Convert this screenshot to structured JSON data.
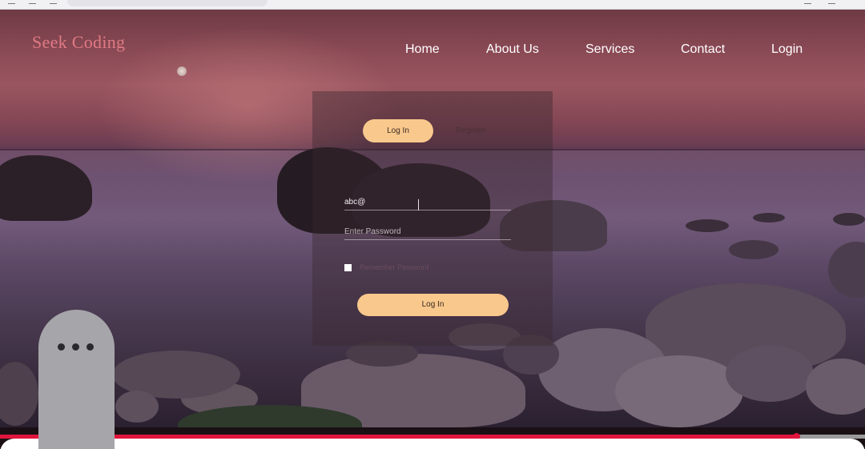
{
  "brand": {
    "name": "Seek Coding"
  },
  "nav": {
    "items": [
      {
        "label": "Home"
      },
      {
        "label": "About Us"
      },
      {
        "label": "Services"
      },
      {
        "label": "Contact"
      },
      {
        "label": "Login"
      }
    ]
  },
  "auth": {
    "tabs": {
      "login": "Log In",
      "register": "Register"
    },
    "email": {
      "value": "abc@"
    },
    "password": {
      "placeholder": "Enter Password",
      "value": ""
    },
    "remember": {
      "label": "Remember Password",
      "checked": false
    },
    "submit_label": "Log In"
  },
  "player": {
    "progress": 0.92
  },
  "colors": {
    "brand": "#e07a84",
    "accent": "#f9c88c",
    "progress": "#e0163c"
  },
  "icons": {
    "overlay": "more-dots-icon"
  }
}
